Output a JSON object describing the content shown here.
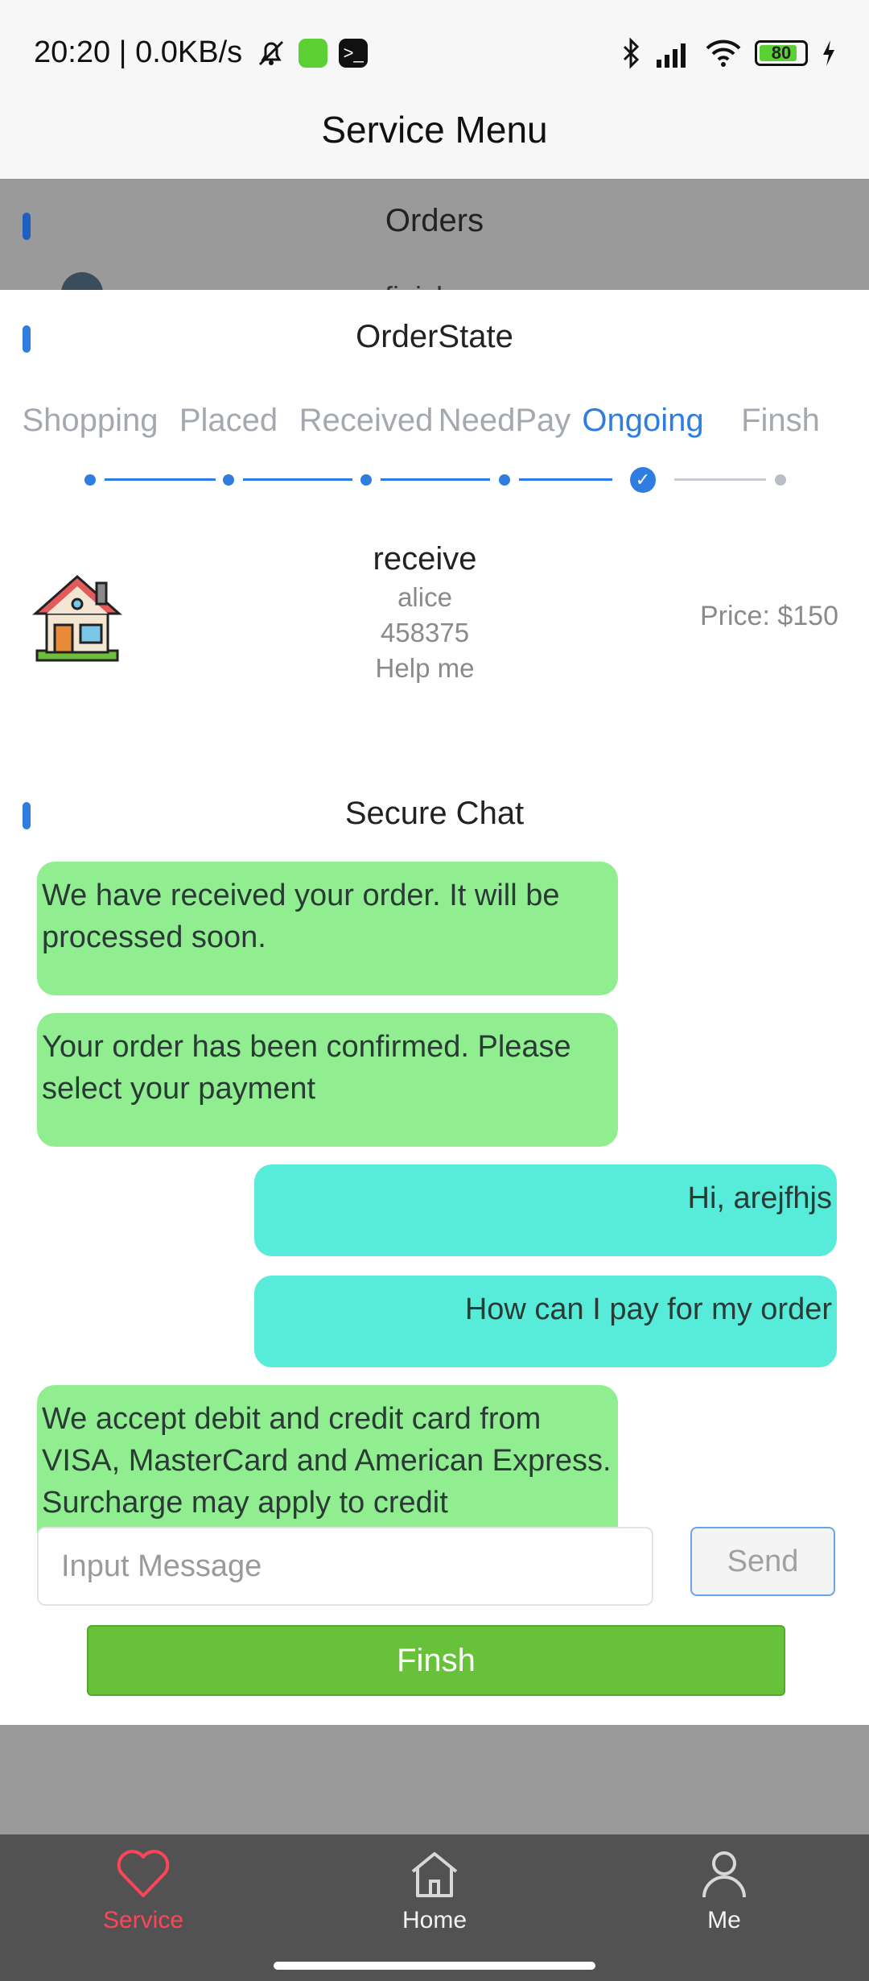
{
  "status_bar": {
    "time_speed": "20:20 | 0.0KB/s",
    "battery": "80"
  },
  "header": {
    "title": "Service Menu"
  },
  "background_page": {
    "section_title": "Orders",
    "peek_text": "finish"
  },
  "order_state": {
    "title": "OrderState",
    "steps": [
      {
        "label": "Shopping",
        "done": true
      },
      {
        "label": "Placed",
        "done": true
      },
      {
        "label": "Received",
        "done": true
      },
      {
        "label": "NeedPay",
        "done": true
      },
      {
        "label": "Ongoing",
        "done": true,
        "current": true
      },
      {
        "label": "Finsh",
        "done": false
      }
    ],
    "accent_color": "#2f7de1"
  },
  "order": {
    "title": "receive",
    "name": "alice",
    "number": "458375",
    "note": "Help me",
    "price": "Price: $150",
    "icon": "house-icon"
  },
  "chat": {
    "title": "Secure Chat",
    "messages": [
      {
        "from": "service",
        "text": "We have received your order. It will be processed soon."
      },
      {
        "from": "service",
        "text": "Your order has been confirmed. Please select your payment"
      },
      {
        "from": "user",
        "text": "Hi, arejfhjs"
      },
      {
        "from": "user",
        "text": "How can I pay for my order"
      },
      {
        "from": "service",
        "text": "We accept debit and credit card from VISA, MasterCard and American Express. Surcharge may apply to credit"
      }
    ],
    "input_placeholder": "Input Message",
    "input_value": "",
    "send_label": "Send",
    "finish_label": "Finsh",
    "colors": {
      "service_bubble": "#90ee90",
      "user_bubble": "#56ecd9",
      "finish_button": "#67c23a"
    }
  },
  "tabbar": {
    "tabs": [
      {
        "label": "Service",
        "icon": "heart-icon",
        "active": true
      },
      {
        "label": "Home",
        "icon": "home-icon",
        "active": false
      },
      {
        "label": "Me",
        "icon": "person-icon",
        "active": false
      }
    ],
    "active_color": "#ff4458"
  }
}
